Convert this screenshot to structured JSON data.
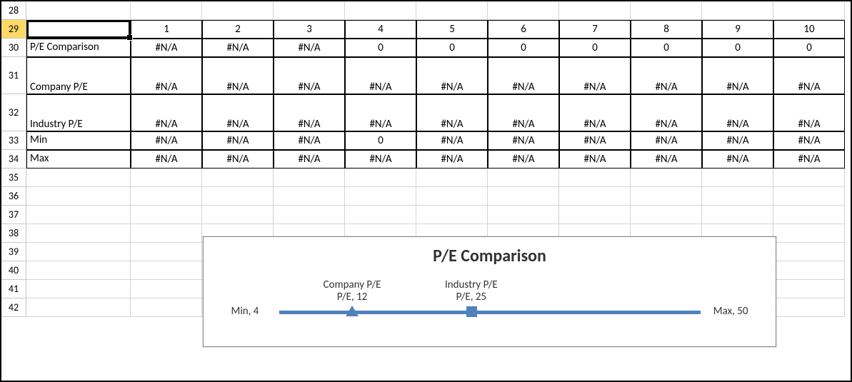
{
  "rows": [
    "28",
    "29",
    "30",
    "31",
    "32",
    "33",
    "34",
    "35",
    "36",
    "37",
    "38",
    "39",
    "40",
    "41",
    "42"
  ],
  "header_cols": [
    "1",
    "2",
    "3",
    "4",
    "5",
    "6",
    "7",
    "8",
    "9",
    "10"
  ],
  "labels": {
    "pe_comparison": "P/E Comparison",
    "company_pe": "Company P/E",
    "industry_pe": "Industry P/E",
    "min": "Min",
    "max": "Max"
  },
  "row30": [
    "#N/A",
    "#N/A",
    "#N/A",
    "0",
    "0",
    "0",
    "0",
    "0",
    "0",
    "0"
  ],
  "row31": [
    "#N/A",
    "#N/A",
    "#N/A",
    "#N/A",
    "#N/A",
    "#N/A",
    "#N/A",
    "#N/A",
    "#N/A",
    "#N/A"
  ],
  "row32": [
    "#N/A",
    "#N/A",
    "#N/A",
    "#N/A",
    "#N/A",
    "#N/A",
    "#N/A",
    "#N/A",
    "#N/A",
    "#N/A"
  ],
  "row33": [
    "#N/A",
    "#N/A",
    "#N/A",
    "0",
    "#N/A",
    "#N/A",
    "#N/A",
    "#N/A",
    "#N/A",
    "#N/A"
  ],
  "row34": [
    "#N/A",
    "#N/A",
    "#N/A",
    "#N/A",
    "#N/A",
    "#N/A",
    "#N/A",
    "#N/A",
    "#N/A",
    "#N/A"
  ],
  "chart_data": {
    "type": "line",
    "title": "P/E Comparison",
    "axis": {
      "min": 4,
      "max": 50
    },
    "points": [
      {
        "name": "Min",
        "value": 4,
        "label": "Min, 4",
        "shape": "none"
      },
      {
        "name": "Company P/E",
        "value": 12,
        "label": "Company P/E, 12",
        "shape": "triangle"
      },
      {
        "name": "Industry P/E",
        "value": 25,
        "label": "Industry P/E, 25",
        "shape": "square"
      },
      {
        "name": "Max",
        "value": 50,
        "label": "Max, 50",
        "shape": "none"
      }
    ]
  }
}
